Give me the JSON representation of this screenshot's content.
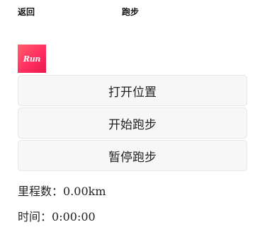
{
  "header": {
    "back_label": "返回",
    "title": "跑步"
  },
  "logo": {
    "text": "Run",
    "icon": "run-logo-icon"
  },
  "buttons": {
    "open_location": "打开位置",
    "start_run": "开始跑步",
    "pause_run": "暂停跑步"
  },
  "stats": {
    "distance_label": "里程数：",
    "distance_value": "0.00km",
    "time_label": "时间：",
    "time_value": "0:00:00"
  },
  "colors": {
    "logo_gradient_start": "#ff5f6d",
    "logo_gradient_end": "#e8194f",
    "button_background": "#f7f7f7",
    "button_border": "#e6e6e6"
  }
}
